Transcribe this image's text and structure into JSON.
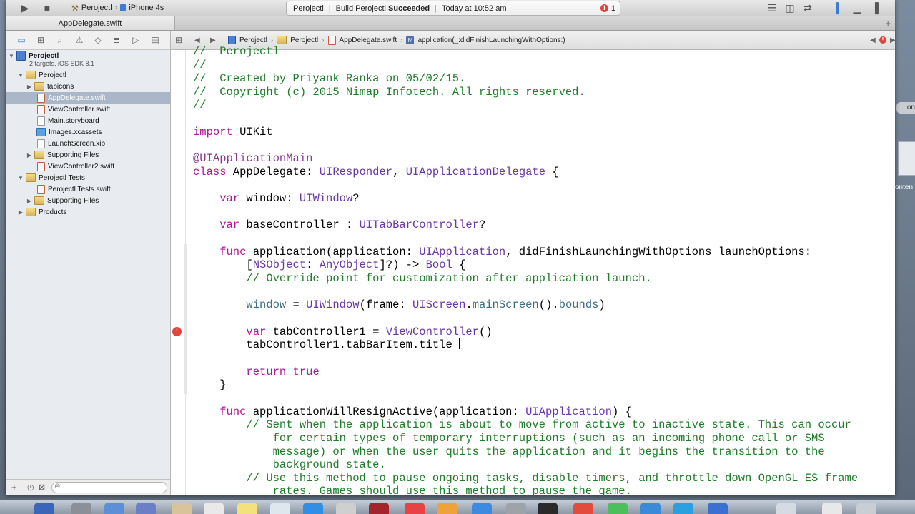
{
  "toolbar": {
    "scheme_project": "Perojectl",
    "scheme_device": "iPhone 4s",
    "activity_project": "Perojectl",
    "activity_build_prefix": "Build Perojectl: ",
    "activity_build_status": "Succeeded",
    "activity_time": "Today at 10:52 am",
    "issues_count": "1"
  },
  "tab": {
    "title": "AppDelegate.swift"
  },
  "navigator": {
    "project_name": "Perojectl",
    "project_sub": "2 targets, iOS SDK 8.1",
    "items": [
      {
        "label": "Perojectl"
      },
      {
        "label": "tabicons"
      },
      {
        "label": "AppDelegate.swift"
      },
      {
        "label": "ViewController.swift"
      },
      {
        "label": "Main.storyboard"
      },
      {
        "label": "Images.xcassets"
      },
      {
        "label": "LaunchScreen.xib"
      },
      {
        "label": "Supporting Files"
      },
      {
        "label": "ViewController2.swift"
      },
      {
        "label": "Perojectl Tests"
      },
      {
        "label": "Perojectl Tests.swift"
      },
      {
        "label": "Supporting Files"
      },
      {
        "label": "Products"
      }
    ]
  },
  "jumpbar": {
    "crumb1": "Perojectl",
    "crumb2": "Perojectl",
    "crumb3": "AppDelegate.swift",
    "crumb4": "application(_:didFinishLaunchingWithOptions:)"
  },
  "code": {
    "l0": "//  Perojectl",
    "l1": "//",
    "l2": "//  Created by Priyank Ranka on 05/02/15.",
    "l3": "//  Copyright (c) 2015 Nimap Infotech. All rights reserved.",
    "l4": "//",
    "l6a": "import",
    "l6b": " UIKit",
    "l8": "@UIApplicationMain",
    "l9a": "class",
    "l9b": " AppDelegate: ",
    "l9c": "UIResponder",
    "l9d": ", ",
    "l9e": "UIApplicationDelegate",
    "l9f": " {",
    "l11a": "    var",
    "l11b": " window: ",
    "l11c": "UIWindow",
    "l11d": "?",
    "l13a": "    var",
    "l13b": " baseController : ",
    "l13c": "UITabBarController",
    "l13d": "?",
    "l15a": "    func",
    "l15b": " application(application: ",
    "l15c": "UIApplication",
    "l15d": ", didFinishLaunchingWithOptions launchOptions:",
    "l16a": "        [",
    "l16b": "NSObject",
    "l16c": ": ",
    "l16d": "AnyObject",
    "l16e": "]?) -> ",
    "l16f": "Bool",
    "l16g": " {",
    "l17": "        // Override point for customization after application launch.",
    "l19a": "        window",
    "l19b": " = ",
    "l19c": "UIWindow",
    "l19d": "(frame: ",
    "l19e": "UIScreen",
    "l19f": ".",
    "l19g": "mainScreen",
    "l19h": "().",
    "l19i": "bounds",
    "l19j": ")",
    "l21a": "        var",
    "l21b": " tabController1 = ",
    "l21c": "ViewController",
    "l21d": "()",
    "l22": "        tabController1.tabBarItem.title ",
    "l24a": "        return",
    "l24b": " true",
    "l25": "    }",
    "l27a": "    func",
    "l27b": " applicationWillResignActive(application: ",
    "l27c": "UIApplication",
    "l27d": ") {",
    "l28": "        // Sent when the application is about to move from active to inactive state. This can occur",
    "l29": "            for certain types of temporary interruptions (such as an incoming phone call or SMS",
    "l30": "            message) or when the user quits the application and it begins the transition to the",
    "l31": "            background state.",
    "l32": "        // Use this method to pause ongoing tasks, disable timers, and throttle down OpenGL ES frame",
    "l33": "            rates. Games should use this method to pause the game."
  },
  "colors": {
    "comment": "#1f7d2a",
    "keyword": "#b0179a",
    "type": "#6a36a8",
    "property": "#3e6d87",
    "selection": "#a9b7c8",
    "error": "#e0443a"
  },
  "desktop": {
    "right_label1": "on",
    "right_label2": "onten"
  }
}
